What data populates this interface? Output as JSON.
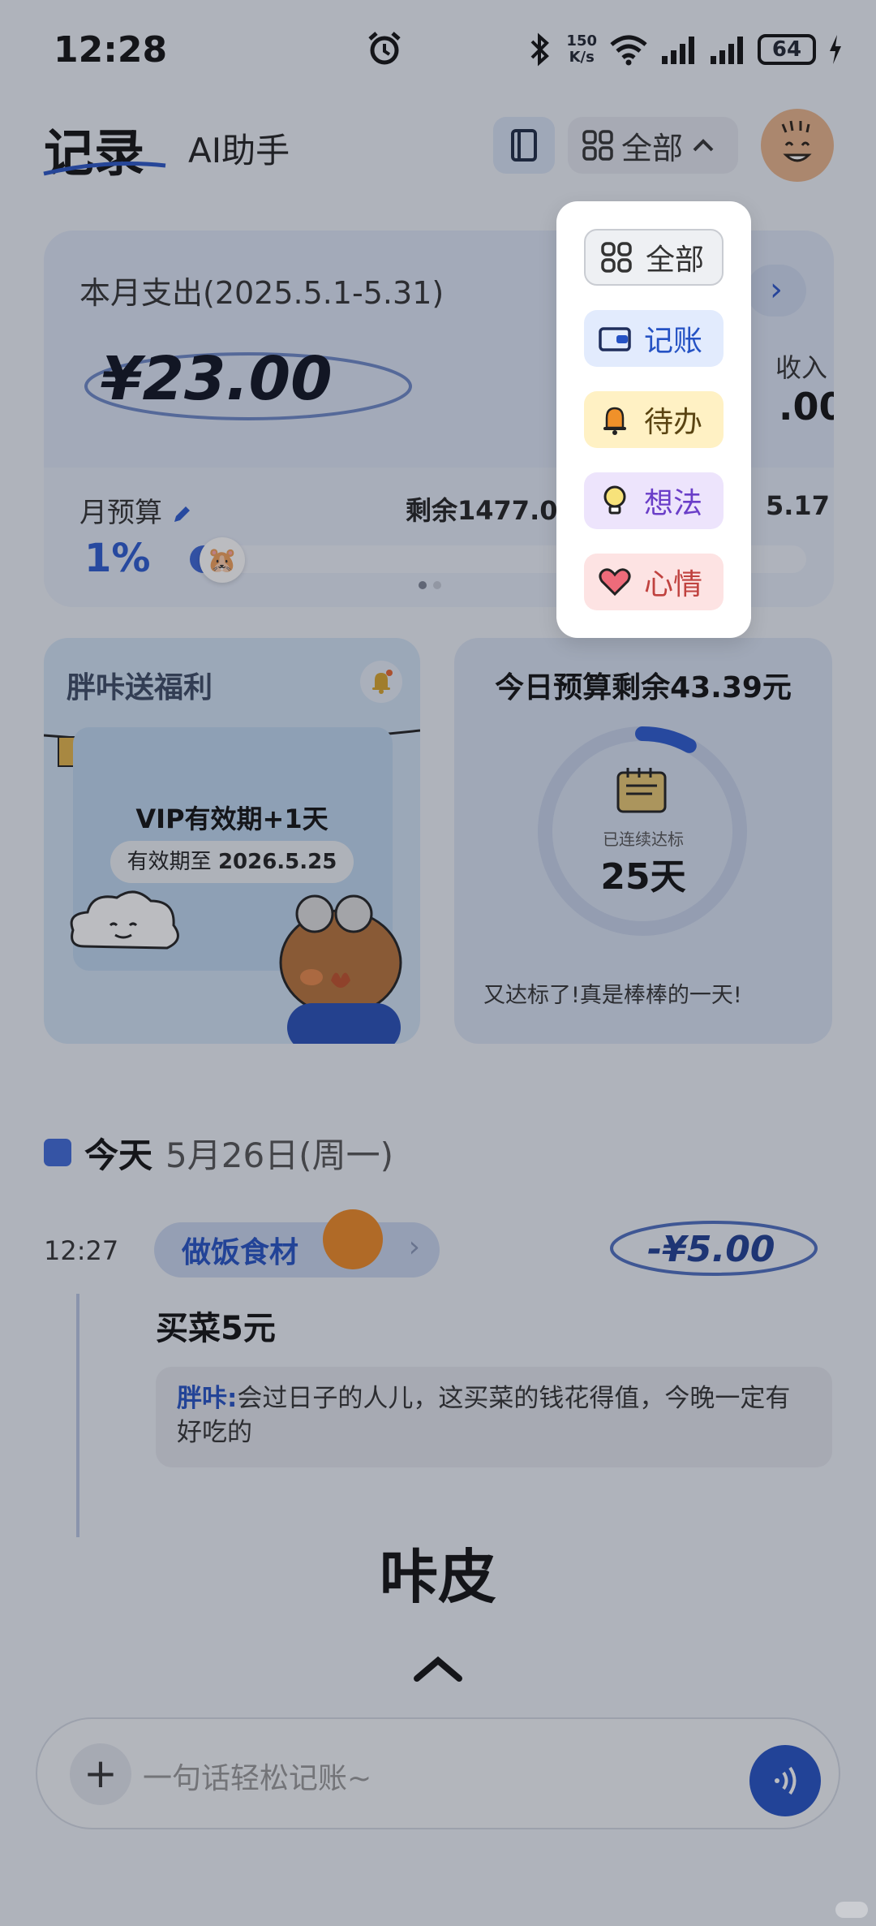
{
  "status_bar": {
    "time": "12:28",
    "net_speed_top": "150",
    "net_speed_bottom": "K/s",
    "battery": "64"
  },
  "header": {
    "title": "记录",
    "ai_tab": "AI助手",
    "filter_label": "全部"
  },
  "summary": {
    "label": "本月支出(2025.5.1-5.31)",
    "amount": "¥23.00",
    "income_label": "收入",
    "income_value": ".00",
    "budget_label": "月预算",
    "budget_percent": "1%",
    "budget_remaining": "剩余1477.00",
    "budget_right_value": "5.17",
    "budget_progress": 0.01
  },
  "welfare": {
    "title": "胖咔送福利",
    "vip_text": "VIP有效期+1天",
    "expiry_prefix": "有效期至 ",
    "expiry_date": "2026.5.25"
  },
  "daily_budget": {
    "title": "今日预算剩余43.39元",
    "streak_label": "已连续达标",
    "streak_value": "25天",
    "message": "又达标了!真是棒棒的一天!",
    "ring_progress": 0.08
  },
  "today": {
    "label": "今天",
    "date": "5月26日(周一)"
  },
  "entry": {
    "time": "12:27",
    "category": "做饭食材",
    "amount": "-¥5.00",
    "title": "买菜5元",
    "note_author": "胖咔:",
    "note_text": "会过日子的人儿，这买菜的钱花得值，今晚一定有好吃的"
  },
  "brand": "咔皮",
  "input": {
    "placeholder": "一句话轻松记账~"
  },
  "dropdown": {
    "items": [
      {
        "label": "全部",
        "icon": "grid-icon"
      },
      {
        "label": "记账",
        "icon": "wallet-icon"
      },
      {
        "label": "待办",
        "icon": "bell-icon"
      },
      {
        "label": "想法",
        "icon": "bulb-icon"
      },
      {
        "label": "心情",
        "icon": "heart-icon"
      }
    ]
  },
  "colors": {
    "accent": "#2552c4",
    "overlay": "#1e222d"
  }
}
